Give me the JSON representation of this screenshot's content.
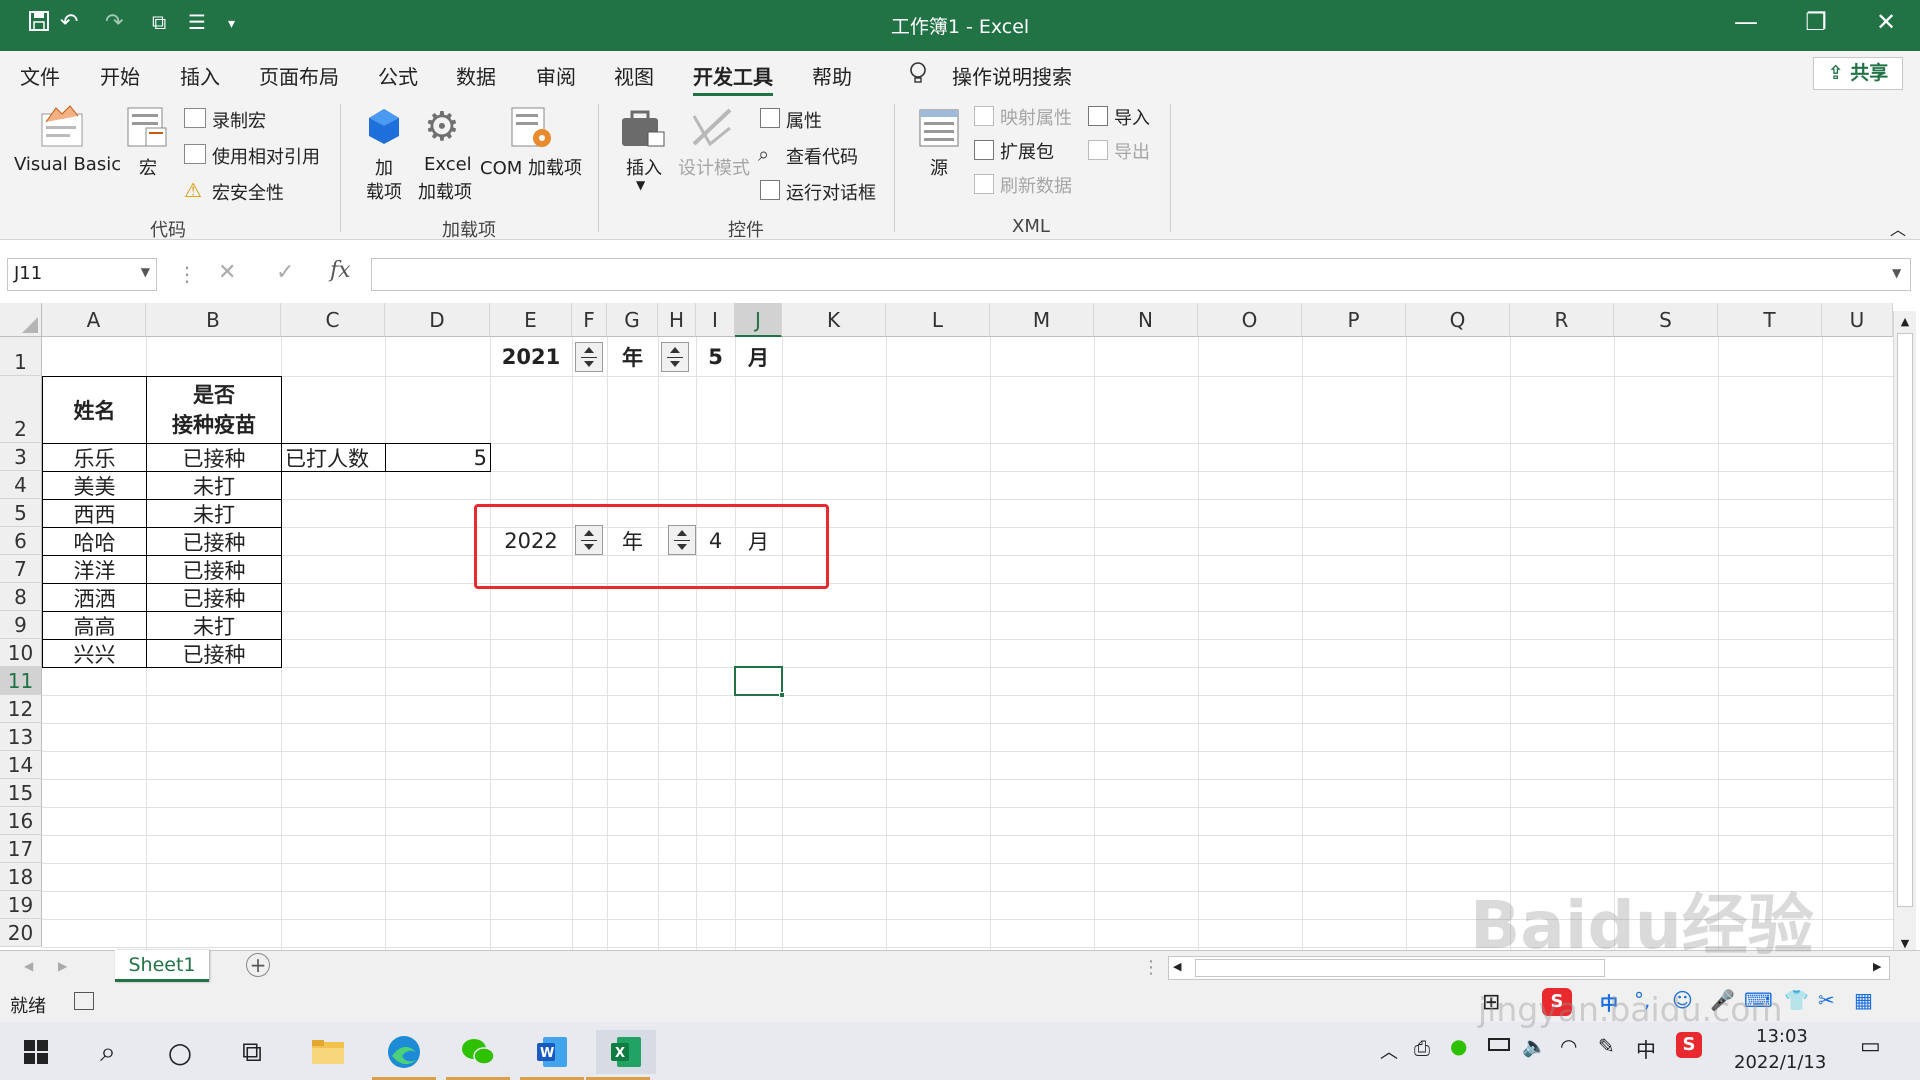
{
  "window": {
    "title": "工作簿1  -  Excel",
    "minimize": "—",
    "restore": "❐",
    "close": "✕"
  },
  "ribbon_tabs": [
    "文件",
    "开始",
    "插入",
    "页面布局",
    "公式",
    "数据",
    "审阅",
    "视图",
    "开发工具",
    "帮助"
  ],
  "active_tab": "开发工具",
  "search_hint": "操作说明搜索",
  "share_label": "共享",
  "ribbon": {
    "code": {
      "group": "代码",
      "visual_basic": "Visual Basic",
      "macros": "宏",
      "record_macro": "录制宏",
      "relative_ref": "使用相对引用",
      "macro_security": "宏安全性"
    },
    "addins": {
      "group": "加载项",
      "addins_l1": "加",
      "addins_l2": "载项",
      "excel_addins_l1": "Excel",
      "excel_addins_l2": "加载项",
      "com_addins": "COM 加载项"
    },
    "controls": {
      "group": "控件",
      "insert": "插入",
      "design_mode": "设计模式",
      "properties": "属性",
      "view_code": "查看代码",
      "run_dialog": "运行对话框"
    },
    "xml": {
      "group": "XML",
      "source": "源",
      "map_props": "映射属性",
      "expansion": "扩展包",
      "refresh": "刷新数据",
      "import": "导入",
      "export": "导出"
    }
  },
  "name_box": "J11",
  "fx_label": "fx",
  "columns": [
    "A",
    "B",
    "C",
    "D",
    "E",
    "F",
    "G",
    "H",
    "I",
    "J",
    "K",
    "L",
    "M",
    "N",
    "O",
    "P",
    "Q",
    "R",
    "S",
    "T",
    "U"
  ],
  "rows": [
    "1",
    "2",
    "3",
    "4",
    "5",
    "6",
    "7",
    "8",
    "9",
    "10",
    "11",
    "12",
    "13",
    "14",
    "15",
    "16",
    "17",
    "18",
    "19",
    "20"
  ],
  "table": {
    "header_name": "姓名",
    "header_vacc_1": "是否",
    "header_vacc_2": "接种疫苗",
    "names": [
      "乐乐",
      "美美",
      "西西",
      "哈哈",
      "洋洋",
      "洒洒",
      "高高",
      "兴兴"
    ],
    "status": [
      "已接种",
      "未打",
      "未打",
      "已接种",
      "已接种",
      "已接种",
      "未打",
      "已接种"
    ]
  },
  "count_label": "已打人数",
  "count_value": "5",
  "row1": {
    "year": "2021",
    "year_unit": "年",
    "month": "5",
    "month_unit": "月"
  },
  "row6": {
    "year": "2022",
    "year_unit": "年",
    "month": "4",
    "month_unit": "月"
  },
  "sheet_tab": "Sheet1",
  "status_ready": "就绪",
  "taskbar": {
    "time": "13:03",
    "date": "2022/1/13",
    "ime_cn": "中"
  },
  "watermark": "Baidu经验",
  "watermark_sub": "jingyan.baidu.com",
  "colors": {
    "excel_green": "#217346",
    "highlight_red": "#e8292e"
  }
}
